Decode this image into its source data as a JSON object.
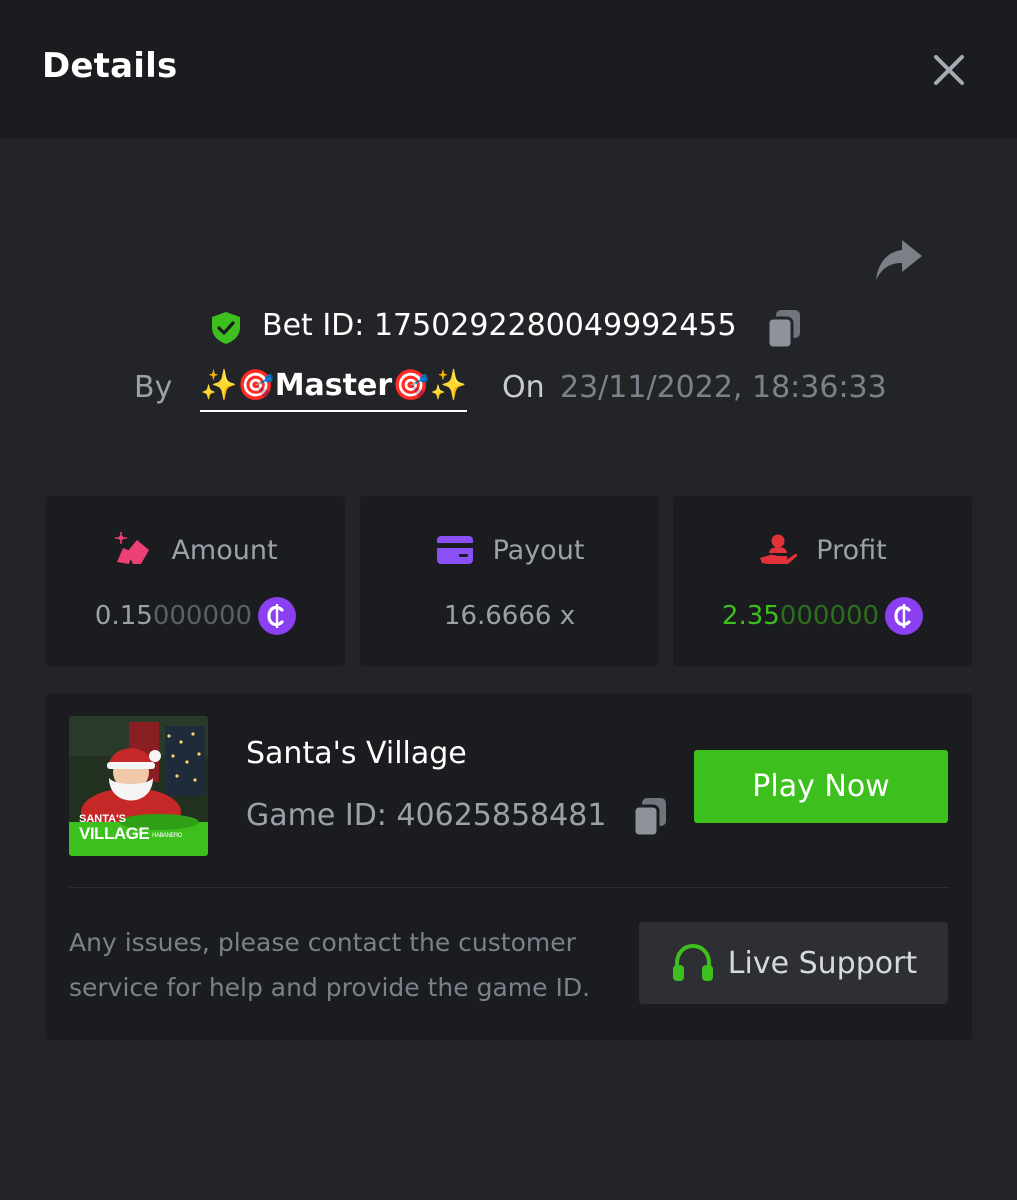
{
  "header": {
    "title": "Details"
  },
  "bet": {
    "prefix": "Bet ID: ",
    "id": "1750292280049992455",
    "by_label": "By",
    "username": "✨🎯Master🎯✨",
    "on_label": "On",
    "datetime": "23/11/2022, 18:36:33"
  },
  "stats": {
    "amount": {
      "label": "Amount",
      "value_main": "0.15",
      "value_dim": "000000"
    },
    "payout": {
      "label": "Payout",
      "value": "16.6666 x"
    },
    "profit": {
      "label": "Profit",
      "value_main": "2.35",
      "value_dim": "000000"
    }
  },
  "game": {
    "name": "Santa's Village",
    "id_prefix": "Game ID: ",
    "id": "40625858481",
    "thumb_line1": "SANTA'S",
    "thumb_line2": "VILLAGE",
    "thumb_brand": "HABANERO",
    "play_label": "Play Now"
  },
  "support": {
    "help_text": "Any issues, please contact the customer service for help and provide the game ID.",
    "button_label": "Live Support"
  },
  "colors": {
    "accent_green": "#3dbf1e",
    "coin_purple": "#8a3ff0",
    "amount_pink": "#ec3f73",
    "payout_purple": "#8a4ff5",
    "profit_red": "#e2323a"
  },
  "icons": [
    "close-icon",
    "share-icon",
    "shield-check-icon",
    "copy-icon",
    "amount-icon",
    "payout-card-icon",
    "profit-hand-icon",
    "coin-icon",
    "headset-icon"
  ]
}
